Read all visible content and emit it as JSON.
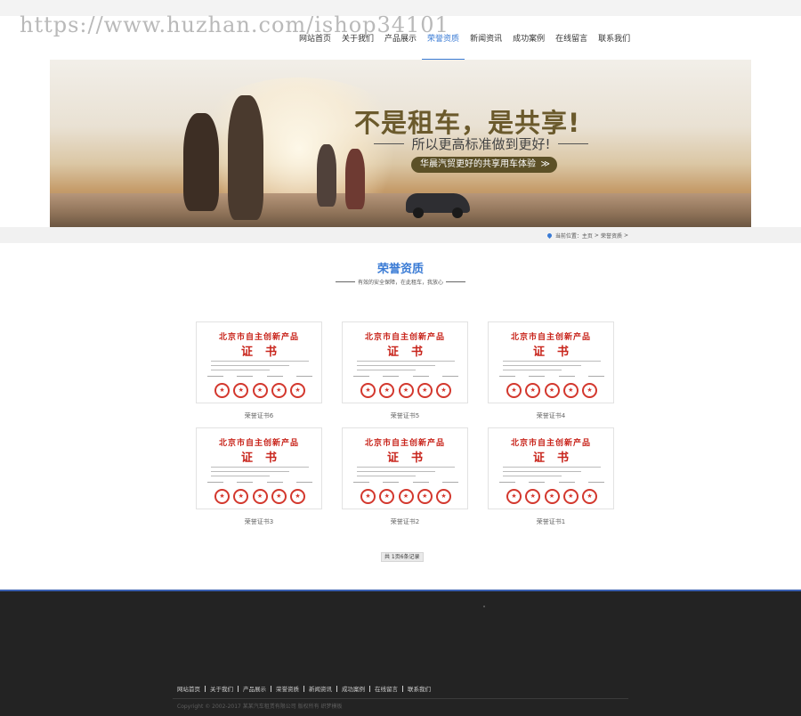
{
  "watermark": "https://www.huzhan.com/ishop34101",
  "nav": {
    "items": [
      "网站首页",
      "关于我们",
      "产品展示",
      "荣誉资质",
      "新闻资讯",
      "成功案例",
      "在线留言",
      "联系我们"
    ],
    "active_index": 3
  },
  "banner": {
    "headline": "不是租车，是共享!",
    "subline": "所以更高标准做到更好!",
    "tag": "华晨汽贸更好的共享用车体验",
    "tag_arrow": "≫"
  },
  "breadcrumb": {
    "prefix": "当前位置：",
    "home": "主页",
    "separator": ">",
    "current": "荣誉资质",
    "trailing": ">"
  },
  "section": {
    "title": "荣誉资质",
    "subtitle": "有效的安全保障，在此租车，我放心"
  },
  "certificates": {
    "title": "北京市自主创新产品",
    "big": "证书",
    "items": [
      {
        "caption": "荣誉证书6"
      },
      {
        "caption": "荣誉证书5"
      },
      {
        "caption": "荣誉证书4"
      },
      {
        "caption": "荣誉证书3"
      },
      {
        "caption": "荣誉证书2"
      },
      {
        "caption": "荣誉证书1"
      }
    ]
  },
  "pager": {
    "text": "共 1页6条记录"
  },
  "footer": {
    "links": [
      "网站首页",
      "关于我们",
      "产品展示",
      "荣誉资质",
      "新闻资讯",
      "成功案例",
      "在线留言",
      "联系我们"
    ],
    "copyright": "Copyright © 2002-2017 某某汽车租赁有限公司 版权所有 织梦模板"
  },
  "colors": {
    "accent": "#3a7bd5",
    "cert_red": "#c8241b",
    "footer_bg": "#232323"
  }
}
